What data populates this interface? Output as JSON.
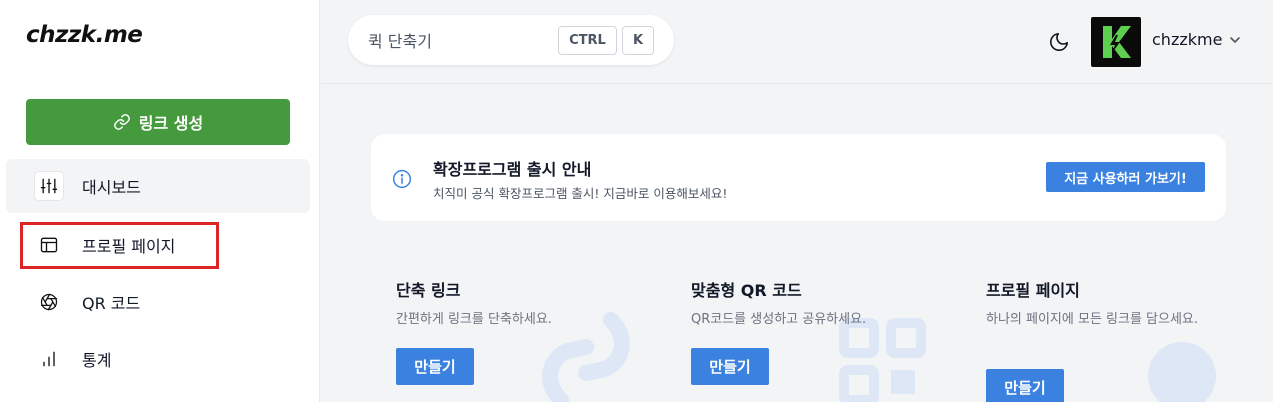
{
  "brand": {
    "logo_text": "chzzk.me"
  },
  "sidebar": {
    "create_label": "링크 생성",
    "items": [
      {
        "label": "대시보드",
        "icon": "sliders-icon",
        "active": true
      },
      {
        "label": "프로필 페이지",
        "icon": "layout-icon",
        "active": false
      },
      {
        "label": "QR 코드",
        "icon": "aperture-icon",
        "active": false
      },
      {
        "label": "통계",
        "icon": "bar-chart-icon",
        "active": false
      }
    ]
  },
  "header": {
    "search_placeholder": "퀵 단축기",
    "shortcut_keys": [
      "CTRL",
      "K"
    ],
    "username": "chzzkme"
  },
  "notice": {
    "title": "확장프로그램 출시 안내",
    "description": "치직미 공식 확장프로그램 출시! 지금바로 이용해보세요!",
    "button_label": "지금 사용하러 가보기!"
  },
  "cards": [
    {
      "title": "단축 링크",
      "description": "간편하게 링크를 단축하세요.",
      "button_label": "만들기"
    },
    {
      "title": "맞춤형 QR 코드",
      "description": "QR코드를 생성하고 공유하세요.",
      "button_label": "만들기"
    },
    {
      "title": "프로필 페이지",
      "description": "하나의 페이지에 모든 링크를 담으세요.",
      "button_label": "만들기"
    }
  ],
  "colors": {
    "brand_green": "#459a3d",
    "accent_blue": "#3b82e0",
    "highlight_red": "#dc2626"
  }
}
